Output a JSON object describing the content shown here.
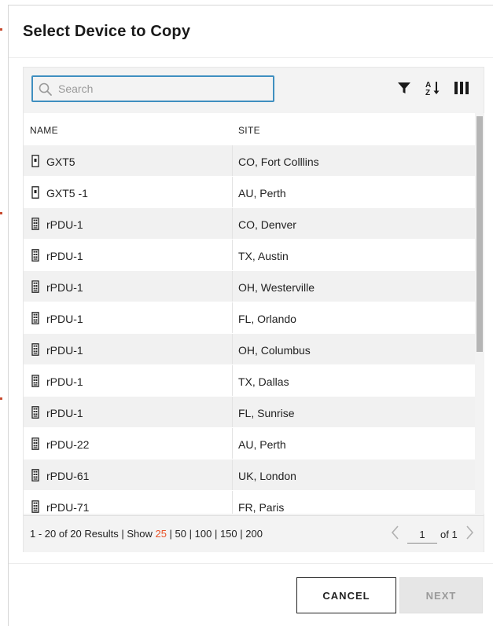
{
  "dialog": {
    "title": "Select Device to Copy"
  },
  "search": {
    "placeholder": "Search",
    "value": ""
  },
  "toolbar": {
    "icons": [
      "filter-icon",
      "sort-az-icon",
      "columns-icon"
    ]
  },
  "table": {
    "columns": [
      "NAME",
      "SITE"
    ],
    "rows": [
      {
        "icon": "ups-device-icon",
        "name": "GXT5",
        "site": "CO, Fort Colllins"
      },
      {
        "icon": "ups-device-icon",
        "name": "GXT5 -1",
        "site": "AU, Perth"
      },
      {
        "icon": "pdu-device-icon",
        "name": "rPDU-1",
        "site": "CO, Denver"
      },
      {
        "icon": "pdu-device-icon",
        "name": "rPDU-1",
        "site": "TX, Austin"
      },
      {
        "icon": "pdu-device-icon",
        "name": "rPDU-1",
        "site": "OH, Westerville"
      },
      {
        "icon": "pdu-device-icon",
        "name": "rPDU-1",
        "site": "FL, Orlando"
      },
      {
        "icon": "pdu-device-icon",
        "name": "rPDU-1",
        "site": "OH, Columbus"
      },
      {
        "icon": "pdu-device-icon",
        "name": "rPDU-1",
        "site": "TX, Dallas"
      },
      {
        "icon": "pdu-device-icon",
        "name": "rPDU-1",
        "site": "FL, Sunrise"
      },
      {
        "icon": "pdu-device-icon",
        "name": "rPDU-22",
        "site": "AU, Perth"
      },
      {
        "icon": "pdu-device-icon",
        "name": "rPDU-61",
        "site": "UK, London"
      },
      {
        "icon": "pdu-device-icon",
        "name": "rPDU-71",
        "site": "FR, Paris"
      }
    ]
  },
  "footer": {
    "results_text": "1 - 20 of 20 Results | Show ",
    "page_sizes": [
      "25",
      "50",
      "100",
      "150",
      "200"
    ],
    "selected_page_size": "25",
    "current_page": "1",
    "of_pages": "of 1"
  },
  "buttons": {
    "cancel": "CANCEL",
    "next": "NEXT"
  },
  "colors": {
    "accent_blue": "#3f8fc0",
    "selected_orange": "#e8542a",
    "disabled_gray": "#9a9a9a"
  }
}
